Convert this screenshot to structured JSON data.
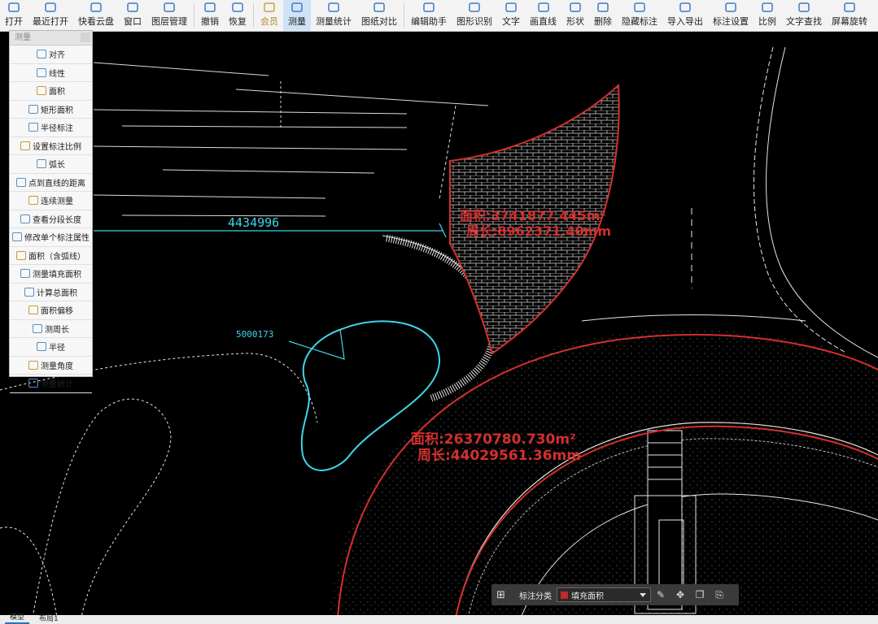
{
  "toolbar": {
    "items": [
      {
        "label": "打开",
        "icon": "folder-open-icon"
      },
      {
        "label": "最近打开",
        "icon": "recent-icon"
      },
      {
        "label": "快看云盘",
        "icon": "cloud-icon"
      },
      {
        "label": "窗口",
        "icon": "window-icon"
      },
      {
        "label": "图层管理",
        "icon": "layers-icon"
      },
      {
        "label": "撤销",
        "icon": "undo-icon"
      },
      {
        "label": "恢复",
        "icon": "redo-icon"
      },
      {
        "label": "会员",
        "icon": "vip-icon"
      },
      {
        "label": "测量",
        "icon": "measure-icon"
      },
      {
        "label": "测量统计",
        "icon": "measure-stats-icon"
      },
      {
        "label": "图纸对比",
        "icon": "compare-icon"
      },
      {
        "label": "编辑助手",
        "icon": "edit-assistant-icon"
      },
      {
        "label": "图形识别",
        "icon": "shape-recognition-icon"
      },
      {
        "label": "文字",
        "icon": "text-icon"
      },
      {
        "label": "画直线",
        "icon": "line-icon"
      },
      {
        "label": "形状",
        "icon": "shape-icon"
      },
      {
        "label": "删除",
        "icon": "delete-icon"
      },
      {
        "label": "隐藏标注",
        "icon": "hide-annotation-icon"
      },
      {
        "label": "导入导出",
        "icon": "import-export-icon"
      },
      {
        "label": "标注设置",
        "icon": "annotation-settings-icon"
      },
      {
        "label": "比例",
        "icon": "scale-icon"
      },
      {
        "label": "文字查找",
        "icon": "text-search-icon"
      },
      {
        "label": "屏幕旋转",
        "icon": "rotate-screen-icon"
      }
    ]
  },
  "measure_panel": {
    "title": "测量",
    "items": [
      {
        "label": "对齐"
      },
      {
        "label": "线性"
      },
      {
        "label": "面积"
      },
      {
        "label": "矩形面积"
      },
      {
        "label": "半径标注"
      },
      {
        "label": "设置标注比例"
      },
      {
        "label": "弧长"
      },
      {
        "label": "点到直线的距离"
      },
      {
        "label": "连续测量"
      },
      {
        "label": "查看分段长度"
      },
      {
        "label": "修改单个标注属性"
      },
      {
        "label": "面积（含弧线）"
      },
      {
        "label": "测量填充面积"
      },
      {
        "label": "计算总面积"
      },
      {
        "label": "面积偏移"
      },
      {
        "label": "测周长"
      },
      {
        "label": "半径"
      },
      {
        "label": "测量角度"
      },
      {
        "label": "测量统计"
      }
    ]
  },
  "drawing": {
    "dim_linear": "4434996",
    "dim_radius": "5000173",
    "area1_label": "面积:3741877.445m²",
    "perimeter1_label": "周长:8962371.40mm",
    "area2_label": "面积:26370780.730m²",
    "perimeter2_label": "周长:44029561.36mm",
    "colors": {
      "measure_red": "#d32f2f",
      "dim_cyan": "#3fd6e8",
      "line_white": "#e6e6e6"
    }
  },
  "annotation_bar": {
    "label": "标注分类",
    "selected": "填充面积",
    "swatch_color": "#c0282b",
    "tools": [
      "edit-icon",
      "move-icon",
      "copy-icon",
      "paste-icon"
    ]
  },
  "statusbar": {
    "tabs": [
      "模型",
      "布局1"
    ]
  }
}
